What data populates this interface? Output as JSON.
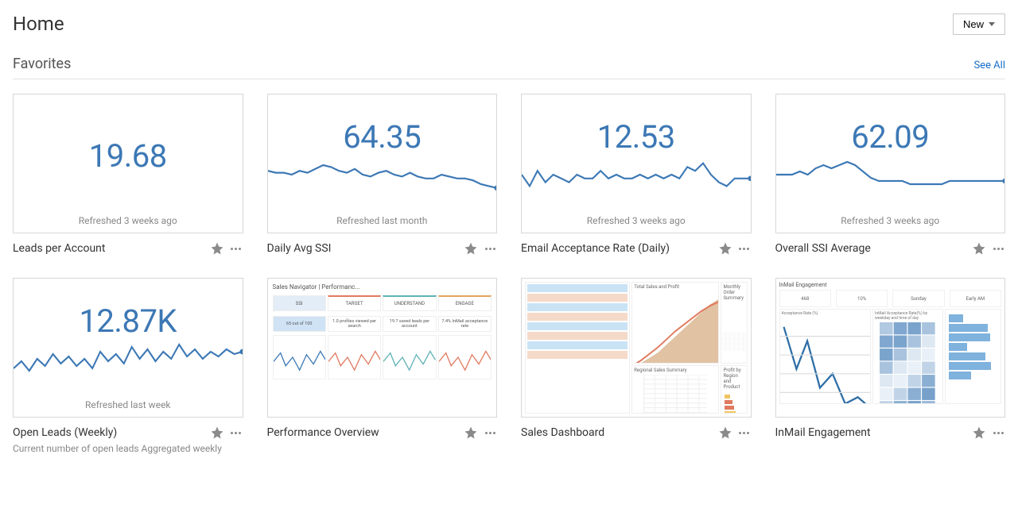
{
  "page": {
    "title": "Home"
  },
  "new_button": {
    "label": "New"
  },
  "section": {
    "title": "Favorites",
    "see_all": "See All"
  },
  "cards": [
    {
      "metric": "19.68",
      "refreshed": "Refreshed 3 weeks ago",
      "title": "Leads per Account",
      "type": "metric_nosparK"
    },
    {
      "metric": "64.35",
      "refreshed": "Refreshed last month",
      "title": "Daily Avg SSI",
      "type": "metric_spark"
    },
    {
      "metric": "12.53",
      "refreshed": "Refreshed 3 weeks ago",
      "title": "Email Acceptance Rate (Daily)",
      "type": "metric_spark"
    },
    {
      "metric": "62.09",
      "refreshed": "Refreshed 3 weeks ago",
      "title": "Overall SSI Average",
      "type": "metric_spark"
    },
    {
      "metric": "12.87K",
      "refreshed": "Refreshed last week",
      "title": "Open Leads (Weekly)",
      "sub": "Current number of open leads Aggregated weekly",
      "type": "metric_spark"
    },
    {
      "title": "Performance Overview",
      "type": "dash_perf",
      "perf": {
        "header": "Sales Navigator | Performanc...",
        "pills": [
          "SSI",
          "TARGET",
          "UNDERSTAND",
          "ENGAGE"
        ],
        "stats": [
          "65 out of 100",
          "1.0 profiles viewed per search",
          "19.7 saved leads per account",
          "7.4% InMail acceptance rate"
        ]
      }
    },
    {
      "title": "Sales Dashboard",
      "type": "dash_sales",
      "sales": {
        "panels": [
          "Total Sales and Profit",
          "Monthly Order Summary",
          "Regional Sales Summary",
          "Profit by Region and Product"
        ]
      }
    },
    {
      "title": "InMail Engagement",
      "type": "dash_inmail",
      "inmail": {
        "header": "InMail Engagement",
        "top": [
          "468",
          "10%",
          "Sunday",
          "Early AM"
        ],
        "bottom_labels": [
          "Acceptance Rate (%)",
          "InMail Acceptance Rate(%) by weekday and time of day",
          ""
        ]
      }
    }
  ],
  "chart_data": [
    {
      "type": "line",
      "title": "Daily Avg SSI sparkline",
      "x": [
        0,
        1,
        2,
        3,
        4,
        5,
        6,
        7,
        8,
        9,
        10,
        11,
        12,
        13,
        14,
        15,
        16,
        17,
        18,
        19,
        20,
        21,
        22,
        23,
        24,
        25,
        26,
        27,
        28,
        29
      ],
      "values": [
        67,
        66,
        66,
        65,
        67,
        66,
        68,
        70,
        69,
        67,
        66,
        68,
        65,
        64,
        66,
        67,
        65,
        64,
        66,
        64,
        63,
        63,
        65,
        64,
        63,
        63,
        62,
        60,
        59,
        58
      ],
      "ylim": [
        55,
        75
      ]
    },
    {
      "type": "line",
      "title": "Email Acceptance Rate (Daily) sparkline",
      "x": [
        0,
        1,
        2,
        3,
        4,
        5,
        6,
        7,
        8,
        9,
        10,
        11,
        12,
        13,
        14,
        15,
        16,
        17,
        18,
        19,
        20,
        21,
        22,
        23,
        24,
        25,
        26,
        27,
        28,
        29
      ],
      "values": [
        13,
        10,
        14,
        11,
        13,
        12,
        11,
        13,
        12,
        12,
        14,
        12,
        13,
        12,
        12,
        13,
        12,
        13,
        12,
        13,
        12,
        15,
        14,
        16,
        13,
        11,
        10,
        12,
        12,
        12
      ],
      "ylim": [
        8,
        18
      ]
    },
    {
      "type": "line",
      "title": "Overall SSI Average sparkline",
      "x": [
        0,
        1,
        2,
        3,
        4,
        5,
        6,
        7,
        8,
        9,
        10,
        11,
        12,
        13,
        14,
        15,
        16,
        17,
        18,
        19,
        20,
        21,
        22,
        23,
        24,
        25,
        26,
        27,
        28,
        29
      ],
      "values": [
        64,
        64,
        64,
        65,
        64,
        66,
        67,
        66,
        67,
        68,
        67,
        65,
        63,
        62,
        62,
        62,
        62,
        61,
        61,
        61,
        61,
        61,
        62,
        62,
        62,
        62,
        62,
        62,
        62,
        62
      ],
      "ylim": [
        58,
        70
      ]
    },
    {
      "type": "line",
      "title": "Open Leads (Weekly) sparkline",
      "x": [
        0,
        1,
        2,
        3,
        4,
        5,
        6,
        7,
        8,
        9,
        10,
        11,
        12,
        13,
        14,
        15,
        16,
        17,
        18,
        19,
        20,
        21,
        22,
        23,
        24,
        25,
        26,
        27,
        28,
        29
      ],
      "values": [
        12.2,
        12.5,
        12.1,
        12.6,
        12.3,
        12.8,
        12.4,
        12.7,
        12.3,
        12.6,
        12.2,
        12.9,
        12.5,
        12.8,
        12.4,
        13.1,
        12.6,
        13.0,
        12.5,
        12.9,
        12.6,
        13.2,
        12.7,
        13.0,
        12.6,
        12.9,
        12.7,
        13.0,
        12.8,
        12.9
      ],
      "ylim": [
        11.8,
        13.4
      ]
    }
  ]
}
